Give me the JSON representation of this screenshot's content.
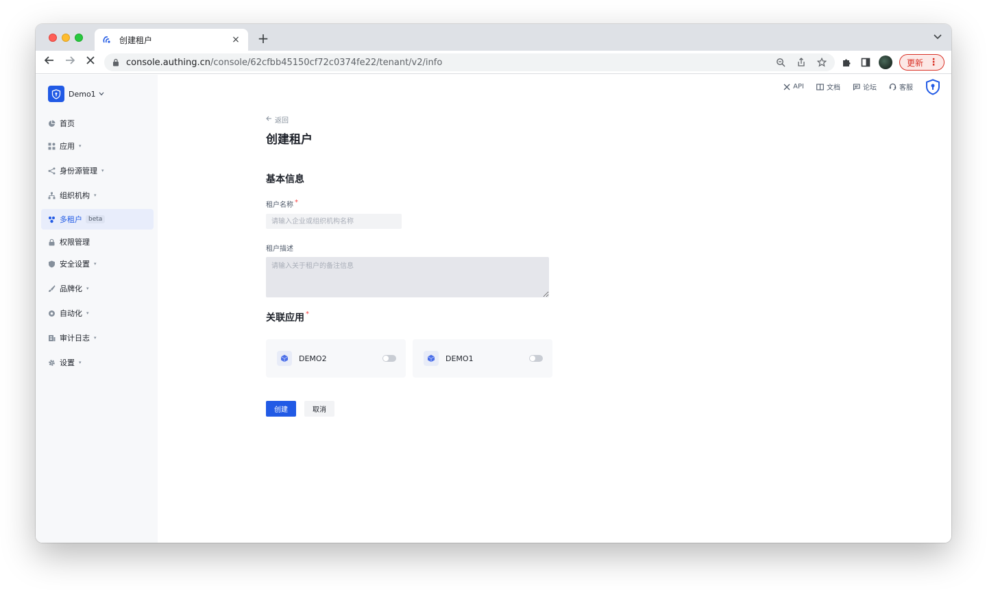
{
  "browser": {
    "tab_title": "创建租户",
    "tab_close": "×",
    "new_tab": "+",
    "tabs_menu": "⌄",
    "url_host": "console.authing.cn",
    "url_path": "/console/62cfbb45150cf72c0374fe22/tenant/v2/info",
    "update_label": "更新",
    "update_menu": "⋮"
  },
  "sidebar": {
    "org_name": "Demo1",
    "items": [
      {
        "label": "首页",
        "has_caret": false
      },
      {
        "label": "应用",
        "has_caret": true
      },
      {
        "label": "身份源管理",
        "has_caret": true
      },
      {
        "label": "组织机构",
        "has_caret": true
      },
      {
        "label": "多租户",
        "badge": "beta",
        "active": true
      },
      {
        "label": "权限管理",
        "has_caret": false
      },
      {
        "label": "安全设置",
        "has_caret": true
      },
      {
        "label": "品牌化",
        "has_caret": true
      },
      {
        "label": "自动化",
        "has_caret": true
      },
      {
        "label": "审计日志",
        "has_caret": true
      },
      {
        "label": "设置",
        "has_caret": true
      }
    ]
  },
  "header": {
    "links": [
      {
        "label": "API",
        "icon": "api-icon"
      },
      {
        "label": "文档",
        "icon": "book-icon"
      },
      {
        "label": "论坛",
        "icon": "forum-icon"
      },
      {
        "label": "客服",
        "icon": "headset-icon"
      }
    ]
  },
  "main": {
    "back_label": "返回",
    "title": "创建租户",
    "basic_section": "基本信息",
    "name_label": "租户名称",
    "name_placeholder": "请输入企业或组织机构名称",
    "desc_label": "租户描述",
    "desc_placeholder": "请输入关于租户的备注信息",
    "apps_section": "关联应用",
    "required_mark": "*",
    "apps": [
      {
        "name": "DEMO2",
        "enabled": false
      },
      {
        "name": "DEMO1",
        "enabled": false
      }
    ],
    "create_button": "创建",
    "cancel_button": "取消"
  },
  "colors": {
    "brand": "#215ae5",
    "required": "#f53f3f"
  }
}
